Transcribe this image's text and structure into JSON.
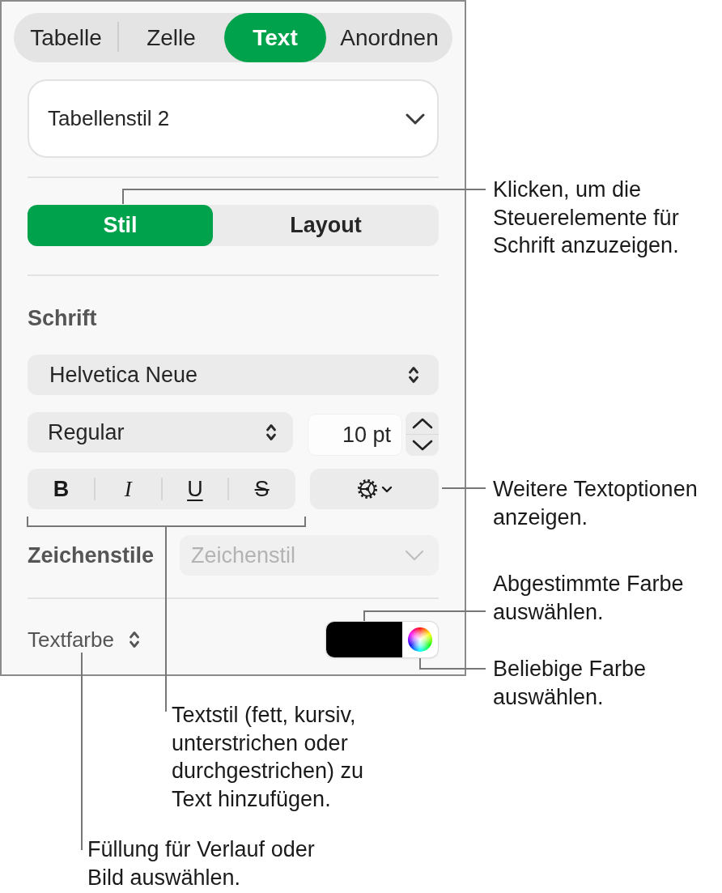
{
  "tabs": [
    {
      "label": "Tabelle",
      "selected": false
    },
    {
      "label": "Zelle",
      "selected": false
    },
    {
      "label": "Text",
      "selected": true
    },
    {
      "label": "Anordnen",
      "selected": false
    }
  ],
  "table_style": {
    "value": "Tabellenstil 2"
  },
  "style_tabs": [
    {
      "label": "Stil",
      "selected": true
    },
    {
      "label": "Layout",
      "selected": false
    }
  ],
  "font": {
    "heading": "Schrift",
    "family": "Helvetica Neue",
    "typeface": "Regular",
    "size": "10 pt"
  },
  "text_style_buttons": [
    {
      "kind": "bold",
      "label": "B"
    },
    {
      "kind": "italic",
      "label": "I"
    },
    {
      "kind": "underline",
      "label": "U"
    },
    {
      "kind": "strikethrough",
      "label": "S"
    }
  ],
  "character_styles": {
    "label": "Zeichenstile",
    "value": "Zeichenstil",
    "disabled": true
  },
  "text_color": {
    "label": "Textfarbe",
    "color": "#000000"
  },
  "callouts": [
    {
      "kind": "segment",
      "text": "Klicken, um die\nSteuerelemente für\nSchrift anzuzeigen."
    },
    {
      "kind": "options",
      "text": "Weitere Textoptionen\nanzeigen."
    },
    {
      "kind": "swatch",
      "text": "Abgestimmte Farbe\nauswählen."
    },
    {
      "kind": "wheel",
      "text": "Beliebige Farbe\nauswählen."
    },
    {
      "kind": "bracket",
      "text": "Textstil (fett, kursiv,\nunterstrichen oder\ndurchgestrichen) zu\nText hinzufügen."
    },
    {
      "kind": "fill",
      "text": "Füllung für Verlauf oder\nBild auswählen."
    }
  ]
}
